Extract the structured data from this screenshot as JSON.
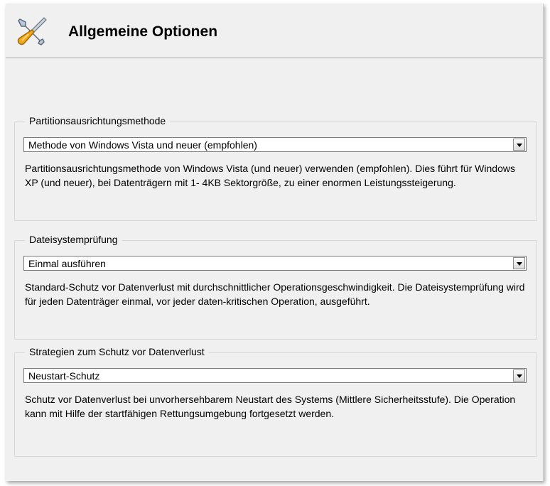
{
  "header": {
    "title": "Allgemeine Optionen",
    "icon": "tools-icon"
  },
  "groups": [
    {
      "legend": "Partitionsausrichtungsmethode",
      "selected": "Methode von Windows Vista und neuer (empfohlen)",
      "description": "Partitionsausrichtungsmethode von Windows Vista (und neuer) verwenden (empfohlen). Dies führt für Windows XP (und neuer), bei Datenträgern mit 1- 4KB Sektorgröße, zu einer enormen Leistungssteigerung."
    },
    {
      "legend": "Dateisystemprüfung",
      "selected": "Einmal ausführen",
      "description": "Standard-Schutz vor Datenverlust mit durchschnittlicher Operationsgeschwindigkeit. Die Dateisystemprüfung wird für jeden Datenträger einmal, vor jeder daten-kritischen Operation, ausgeführt."
    },
    {
      "legend": "Strategien zum Schutz vor Datenverlust",
      "selected": "Neustart-Schutz",
      "description": "Schutz vor Datenverlust bei unvorhersehbarem Neustart des Systems (Mittlere Sicherheitsstufe). Die Operation kann mit Hilfe der startfähigen Rettungsumgebung fortgesetzt werden."
    }
  ]
}
